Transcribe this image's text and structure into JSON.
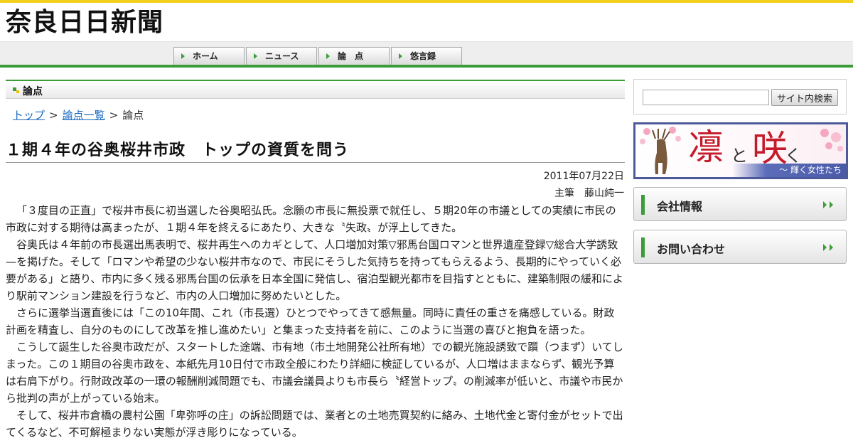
{
  "header": {
    "logo_text": "奈良日日新聞"
  },
  "nav": {
    "items": [
      {
        "label": "ホーム"
      },
      {
        "label": "ニュース"
      },
      {
        "label": "論　点"
      },
      {
        "label": "悠言録"
      }
    ]
  },
  "section": {
    "title": "論点"
  },
  "breadcrumb": {
    "top": "トップ",
    "list": "論点一覧",
    "current": "論点",
    "separator": ">"
  },
  "article": {
    "title": "１期４年の谷奥桜井市政　トップの資質を問う",
    "date": "2011年07月22日",
    "author": "主筆　藤山純一",
    "paragraphs": [
      "「３度目の正直」で桜井市長に初当選した谷奥昭弘氏。念願の市長に無投票で就任し、５期20年の市議としての実績に市民の市政に対する期待は高まったが、１期４年を終えるにあたり、大きな〝失政〟が浮上してきた。",
      "谷奥氏は４年前の市長選出馬表明で、桜井再生へのカギとして、人口増加対策▽邪馬台国ロマンと世界遺産登録▽総合大学誘致—を掲げた。そして「ロマンや希望の少ない桜井市なので、市民にそうした気持ちを持ってもらえるよう、長期的にやっていく必要がある」と語り、市内に多く残る邪馬台国の伝承を日本全国に発信し、宿泊型観光都市を目指すとともに、建築制限の緩和により駅前マンション建設を行うなど、市内の人口増加に努めたいとした。",
      "さらに選挙当選直後には「この10年間、これ（市長選）ひとつでやってきて感無量。同時に責任の重さを痛感している。財政計画を精査し、自分のものにして改革を推し進めたい」と集まった支持者を前に、このように当選の喜びと抱負を語った。",
      "こうして誕生した谷奥市政だが、スタートした途端、市有地（市土地開発公社所有地）での観光施設誘致で躓（つまず）いてしまった。この１期目の谷奥市政を、本紙先月10日付で市政全般にわたり詳細に検証しているが、人口増はままならず、観光予算は右肩下がり。行財政改革の一環の報酬削減問題でも、市議会議員よりも市長ら〝経営トップ〟の削減率が低いと、市議や市民から批判の声が上がっている始末。",
      "そして、桜井市倉橋の農村公園「卑弥呼の庄」の訴訟問題では、業者との土地売買契約に絡み、土地代金と寄付金がセットで出てくるなど、不可解極まりない実態が浮き彫りになっている。"
    ]
  },
  "sidebar": {
    "search_placeholder": "",
    "search_button": "サイト内検索",
    "banner": {
      "char1": "凛",
      "char2": "と",
      "char3": "咲",
      "char4": "く",
      "subtitle": "〜 輝く女性たち"
    },
    "links": [
      {
        "label": "会社情報"
      },
      {
        "label": "お問い合わせ"
      }
    ]
  },
  "colors": {
    "accent_green": "#3c9c3a",
    "top_stripe_yellow": "#f3cf1e",
    "link_blue": "#1a6bc2",
    "banner_red": "#c41a2a"
  }
}
